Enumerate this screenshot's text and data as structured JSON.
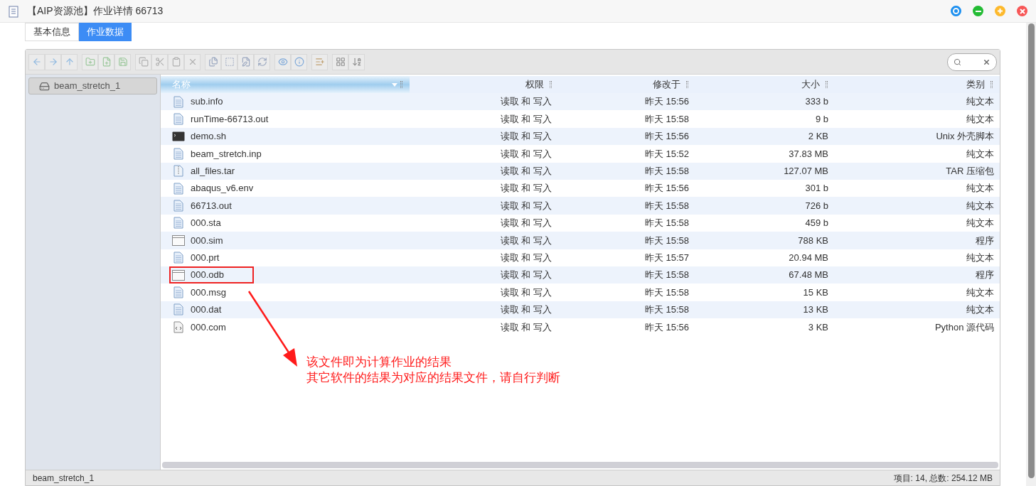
{
  "window": {
    "title": "【AIP资源池】作业详情 66713"
  },
  "tabs": [
    {
      "label": "基本信息",
      "selected": false
    },
    {
      "label": "作业数据",
      "selected": true
    }
  ],
  "sidebar": {
    "items": [
      {
        "label": "beam_stretch_1",
        "selected": true
      }
    ]
  },
  "table": {
    "columns": [
      {
        "label": "名称",
        "sorted": true
      },
      {
        "label": "权限",
        "sorted": false
      },
      {
        "label": "修改于",
        "sorted": false
      },
      {
        "label": "大小",
        "sorted": false
      },
      {
        "label": "类别",
        "sorted": false
      }
    ],
    "rows": [
      {
        "kind": "text",
        "name": "sub.info",
        "perm": "读取 和 写入",
        "modified": "昨天 15:56",
        "size": "333 b",
        "type": "纯文本",
        "highlighted": false
      },
      {
        "kind": "text",
        "name": "runTime-66713.out",
        "perm": "读取 和 写入",
        "modified": "昨天 15:58",
        "size": "9 b",
        "type": "纯文本",
        "highlighted": false
      },
      {
        "kind": "terminal",
        "name": "demo.sh",
        "perm": "读取 和 写入",
        "modified": "昨天 15:56",
        "size": "2 KB",
        "type": "Unix 外壳脚本",
        "highlighted": false
      },
      {
        "kind": "text",
        "name": "beam_stretch.inp",
        "perm": "读取 和 写入",
        "modified": "昨天 15:52",
        "size": "37.83 MB",
        "type": "纯文本",
        "highlighted": false
      },
      {
        "kind": "archive",
        "name": "all_files.tar",
        "perm": "读取 和 写入",
        "modified": "昨天 15:58",
        "size": "127.07 MB",
        "type": "TAR 压缩包",
        "highlighted": false
      },
      {
        "kind": "text",
        "name": "abaqus_v6.env",
        "perm": "读取 和 写入",
        "modified": "昨天 15:56",
        "size": "301 b",
        "type": "纯文本",
        "highlighted": false
      },
      {
        "kind": "text",
        "name": "66713.out",
        "perm": "读取 和 写入",
        "modified": "昨天 15:58",
        "size": "726 b",
        "type": "纯文本",
        "highlighted": false
      },
      {
        "kind": "text",
        "name": "000.sta",
        "perm": "读取 和 写入",
        "modified": "昨天 15:58",
        "size": "459 b",
        "type": "纯文本",
        "highlighted": false
      },
      {
        "kind": "binary",
        "name": "000.sim",
        "perm": "读取 和 写入",
        "modified": "昨天 15:58",
        "size": "788 KB",
        "type": "程序",
        "highlighted": false
      },
      {
        "kind": "text",
        "name": "000.prt",
        "perm": "读取 和 写入",
        "modified": "昨天 15:57",
        "size": "20.94 MB",
        "type": "纯文本",
        "highlighted": false
      },
      {
        "kind": "binary",
        "name": "000.odb",
        "perm": "读取 和 写入",
        "modified": "昨天 15:58",
        "size": "67.48 MB",
        "type": "程序",
        "highlighted": true
      },
      {
        "kind": "text",
        "name": "000.msg",
        "perm": "读取 和 写入",
        "modified": "昨天 15:58",
        "size": "15 KB",
        "type": "纯文本",
        "highlighted": false
      },
      {
        "kind": "text",
        "name": "000.dat",
        "perm": "读取 和 写入",
        "modified": "昨天 15:58",
        "size": "13 KB",
        "type": "纯文本",
        "highlighted": false
      },
      {
        "kind": "code",
        "name": "000.com",
        "perm": "读取 和 写入",
        "modified": "昨天 15:56",
        "size": "3 KB",
        "type": "Python 源代码",
        "highlighted": false
      }
    ]
  },
  "annotation": {
    "lines": [
      "该文件即为计算作业的结果",
      "其它软件的结果为对应的结果文件，请自行判断"
    ]
  },
  "status_bar": {
    "left": "beam_stretch_1",
    "right": "项目: 14, 总数: 254.12 MB"
  }
}
